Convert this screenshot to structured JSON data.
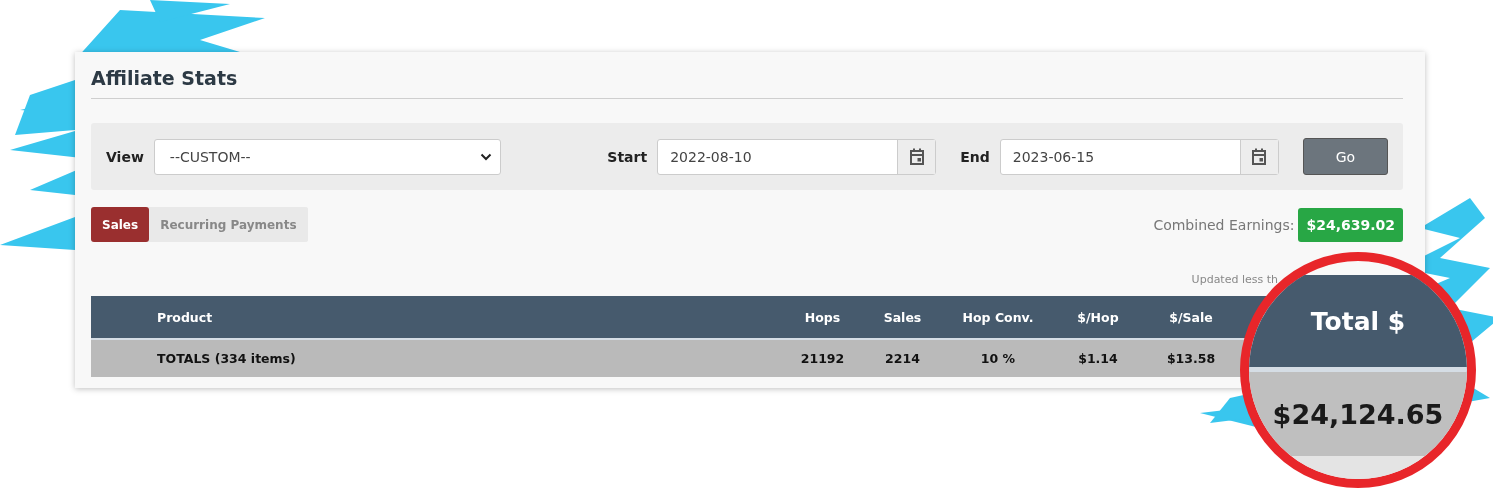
{
  "page": {
    "title": "Affiliate Stats"
  },
  "filters": {
    "view": {
      "label": "View",
      "value": "--CUSTOM--"
    },
    "start": {
      "label": "Start",
      "value": "2022-08-10"
    },
    "end": {
      "label": "End",
      "value": "2023-06-15"
    },
    "go_button": "Go"
  },
  "tabs": [
    {
      "label": "Sales",
      "selected": true
    },
    {
      "label": "Recurring Payments",
      "selected": false
    }
  ],
  "combined_earnings": {
    "label": "Combined Earnings:",
    "value": "$24,639.02"
  },
  "updated_note": "Updated less th",
  "table": {
    "columns": [
      "Product",
      "Hops",
      "Sales",
      "Hop Conv.",
      "$/Hop",
      "$/Sale"
    ],
    "totals_row": [
      "TOTALS (334 items)",
      "21192",
      "2214",
      "10 %",
      "$1.14",
      "$13.58"
    ]
  },
  "magnifier": {
    "header": "Total $",
    "value": "$24,124.65"
  }
}
